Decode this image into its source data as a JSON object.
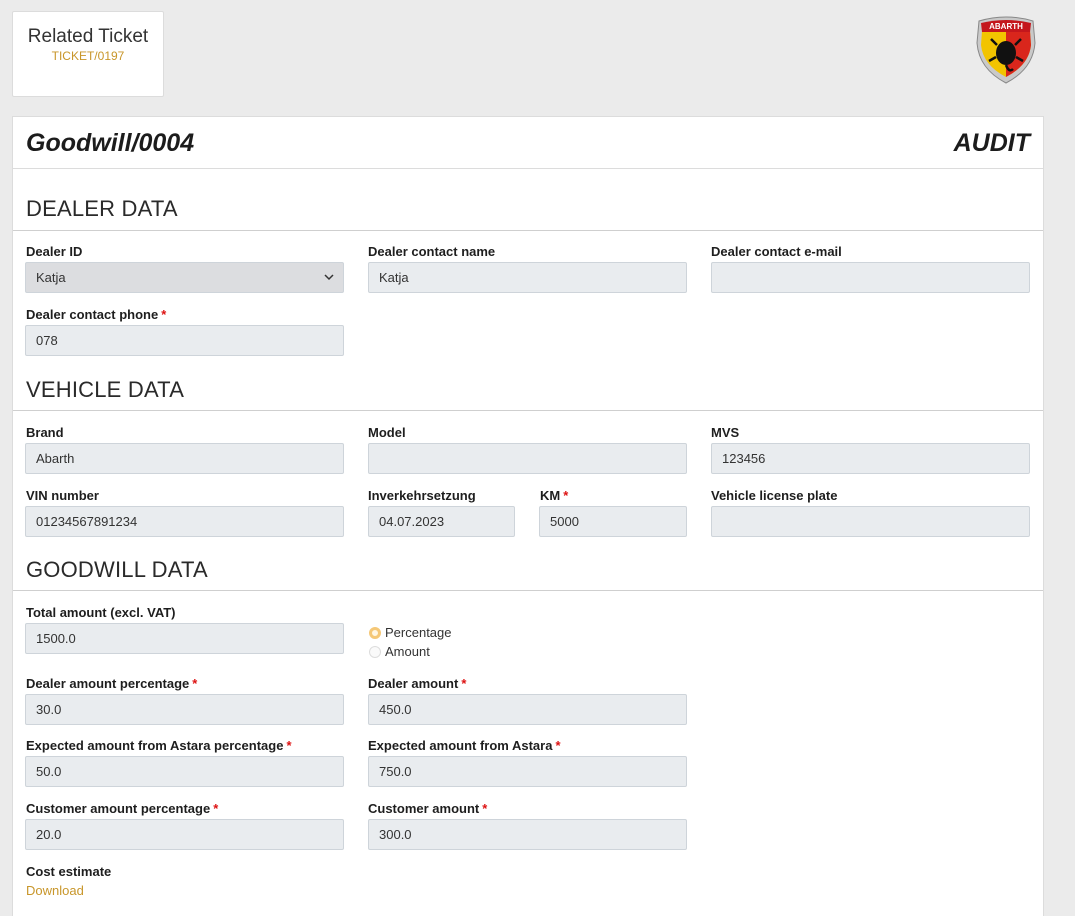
{
  "related": {
    "title": "Related Ticket",
    "link": "TICKET/0197"
  },
  "logo": {
    "brand_text": "ABARTH",
    "icon": "abarth-scorpion-shield-logo"
  },
  "header": {
    "title": "Goodwill/0004",
    "status": "AUDIT"
  },
  "dealer": {
    "section_title": "DEALER DATA",
    "dealer_id_label": "Dealer ID",
    "dealer_id_value": "Katja",
    "contact_name_label": "Dealer contact name",
    "contact_name_value": "Katja",
    "contact_email_label": "Dealer contact e-mail",
    "contact_email_value": "",
    "contact_phone_label": "Dealer contact phone",
    "contact_phone_value": "078"
  },
  "vehicle": {
    "section_title": "VEHICLE DATA",
    "brand_label": "Brand",
    "brand_value": "Abarth",
    "model_label": "Model",
    "model_value": "",
    "mvs_label": "MVS",
    "mvs_value": "123456",
    "vin_label": "VIN number",
    "vin_value": "01234567891234",
    "registration_label": "Inverkehrsetzung",
    "registration_value": "04.07.2023",
    "km_label": "KM",
    "km_value": "5000",
    "plate_label": "Vehicle license plate",
    "plate_value": ""
  },
  "goodwill": {
    "section_title": "GOODWILL DATA",
    "total_label": "Total amount (excl. VAT)",
    "total_value": "1500.0",
    "mode_options": [
      "Percentage",
      "Amount"
    ],
    "mode_selected": "Percentage",
    "dealer_pct_label": "Dealer amount percentage",
    "dealer_pct_value": "30.0",
    "dealer_amt_label": "Dealer amount",
    "dealer_amt_value": "450.0",
    "astara_pct_label": "Expected amount from Astara percentage",
    "astara_pct_value": "50.0",
    "astara_amt_label": "Expected amount from Astara",
    "astara_amt_value": "750.0",
    "customer_pct_label": "Customer amount percentage",
    "customer_pct_value": "20.0",
    "customer_amt_label": "Customer amount",
    "customer_amt_value": "300.0",
    "cost_estimate_label": "Cost estimate",
    "download_label": "Download"
  },
  "required_mark": "*",
  "colors": {
    "accent": "#c8962a",
    "required": "#dd1111",
    "field_bg": "#e9ecef"
  }
}
